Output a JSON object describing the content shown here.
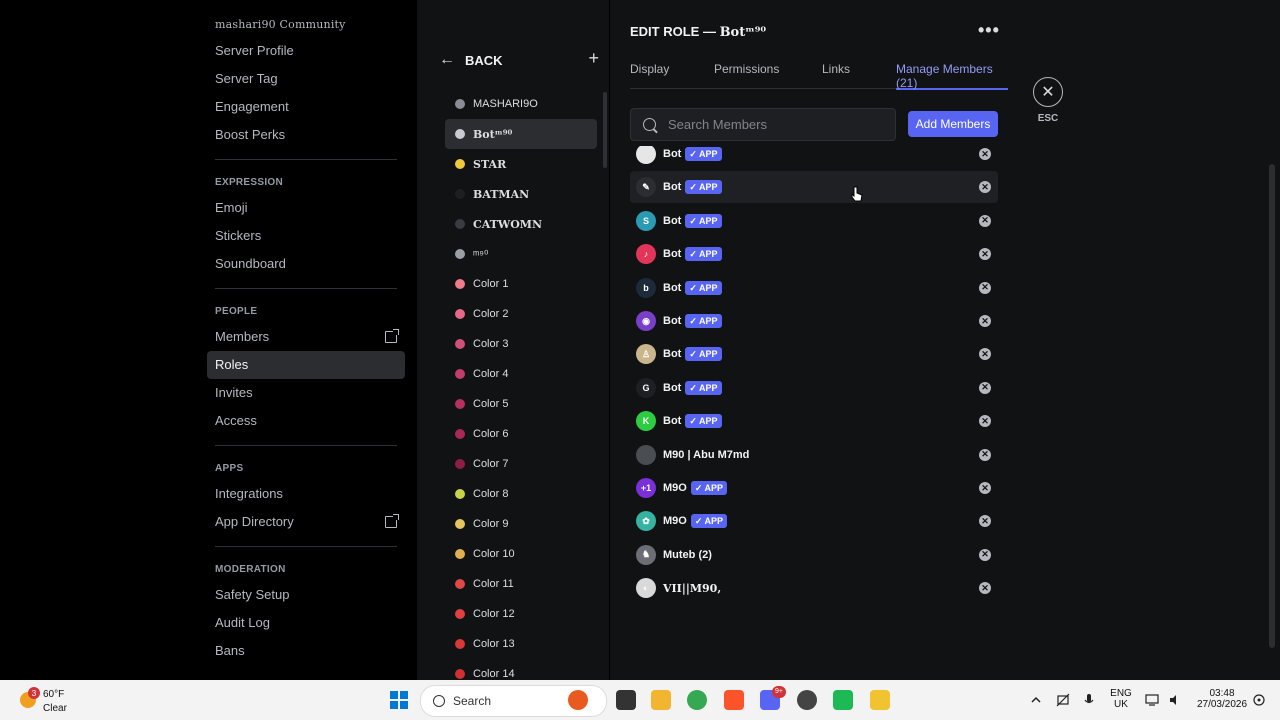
{
  "window": {
    "minimize": "—",
    "maximize": "☐",
    "close": "✕"
  },
  "sidebar": {
    "community": "mashari90 Community",
    "top_items": [
      "Server Profile",
      "Server Tag",
      "Engagement",
      "Boost Perks"
    ],
    "sections": [
      {
        "header": "EXPRESSION",
        "items": [
          "Emoji",
          "Stickers",
          "Soundboard"
        ]
      },
      {
        "header": "PEOPLE",
        "items": [
          "Members",
          "Roles",
          "Invites",
          "Access"
        ]
      },
      {
        "header": "APPS",
        "items": [
          "Integrations",
          "App Directory"
        ]
      },
      {
        "header": "MODERATION",
        "items": [
          "Safety Setup",
          "Audit Log",
          "Bans"
        ]
      }
    ],
    "active_item": "Roles"
  },
  "roles": {
    "back_label": "BACK",
    "add_label": "+",
    "list": [
      {
        "name": "MASHARI9O",
        "color": "#8a8d93"
      },
      {
        "name": "Botᵐ⁹⁰",
        "color": "#c8ccd2",
        "serif": true,
        "selected": true
      },
      {
        "name": "STAR",
        "color": "#f0c93a",
        "serif": true
      },
      {
        "name": "BATMAN",
        "color": "#1e1f22",
        "serif": true
      },
      {
        "name": "CATWOMN",
        "color": "#3a3c42",
        "serif": true
      },
      {
        "name": "ᵐ⁹⁰",
        "color": "#9aa0a6"
      },
      {
        "name": "Color 1",
        "color": "#f27a8a"
      },
      {
        "name": "Color 2",
        "color": "#e8688a"
      },
      {
        "name": "Color 3",
        "color": "#d0507a"
      },
      {
        "name": "Color 4",
        "color": "#c43c6a"
      },
      {
        "name": "Color 5",
        "color": "#b83060"
      },
      {
        "name": "Color 6",
        "color": "#a82858"
      },
      {
        "name": "Color 7",
        "color": "#8e1e48"
      },
      {
        "name": "Color 8",
        "color": "#c8d24a"
      },
      {
        "name": "Color 9",
        "color": "#e6c55a"
      },
      {
        "name": "Color 10",
        "color": "#e0b050"
      },
      {
        "name": "Color 11",
        "color": "#e04848"
      },
      {
        "name": "Color 12",
        "color": "#e04040"
      },
      {
        "name": "Color 13",
        "color": "#d83838"
      },
      {
        "name": "Color 14",
        "color": "#d03030"
      }
    ]
  },
  "main": {
    "title_prefix": "EDIT ROLE — ",
    "role_name": "Botᵐ⁹⁰",
    "more": "•••",
    "tabs": [
      "Display",
      "Permissions",
      "Links",
      "Manage Members (21)"
    ],
    "active_tab": "Manage Members (21)",
    "search_placeholder": "Search Members",
    "add_members_label": "Add Members",
    "app_badge": "✓ APP",
    "remove_glyph": "✕",
    "members": [
      {
        "name": "Bot",
        "app": true,
        "avatar_color": "#e6e6e6",
        "glyph": ""
      },
      {
        "name": "Bot",
        "app": true,
        "avatar_color": "#2b2d31",
        "glyph": "✎",
        "hover": true
      },
      {
        "name": "Bot",
        "app": true,
        "avatar_color": "#2a9bb3",
        "glyph": "S"
      },
      {
        "name": "Bot",
        "app": true,
        "avatar_color": "#e3345a",
        "glyph": "♪"
      },
      {
        "name": "Bot",
        "app": true,
        "avatar_color": "#1d2a3c",
        "glyph": "b"
      },
      {
        "name": "Bot",
        "app": true,
        "avatar_color": "#7a3fc8",
        "glyph": "◉"
      },
      {
        "name": "Bot",
        "app": true,
        "avatar_color": "#c9b68c",
        "glyph": "♙"
      },
      {
        "name": "Bot",
        "app": true,
        "avatar_color": "#1e1f22",
        "glyph": "G"
      },
      {
        "name": "Bot",
        "app": true,
        "avatar_color": "#2ecc40",
        "glyph": "K"
      },
      {
        "name": "M90 | Abu M7md",
        "app": false,
        "avatar_color": "#4a4d52",
        "glyph": ""
      },
      {
        "name": "M9O",
        "app": true,
        "avatar_color": "#7a2fd8",
        "glyph": "+1"
      },
      {
        "name": "M9O",
        "app": true,
        "avatar_color": "#36b3a0",
        "glyph": "✿"
      },
      {
        "name": "Muteb (2)",
        "app": false,
        "avatar_color": "#6b6e74",
        "glyph": "♞"
      },
      {
        "name": "VII||M90,",
        "app": false,
        "avatar_color": "#d9d9d9",
        "glyph": "◐",
        "serif": true
      }
    ]
  },
  "esc": {
    "glyph": "✕",
    "label": "ESC"
  },
  "taskbar": {
    "weather_badge": "3",
    "weather_temp": "60°F",
    "weather_cond": "Clear",
    "search_label": "Search",
    "discord_badge": "9+",
    "lang_top": "ENG",
    "lang_bottom": "UK",
    "time": "03:48",
    "date": "27/03/2026"
  }
}
